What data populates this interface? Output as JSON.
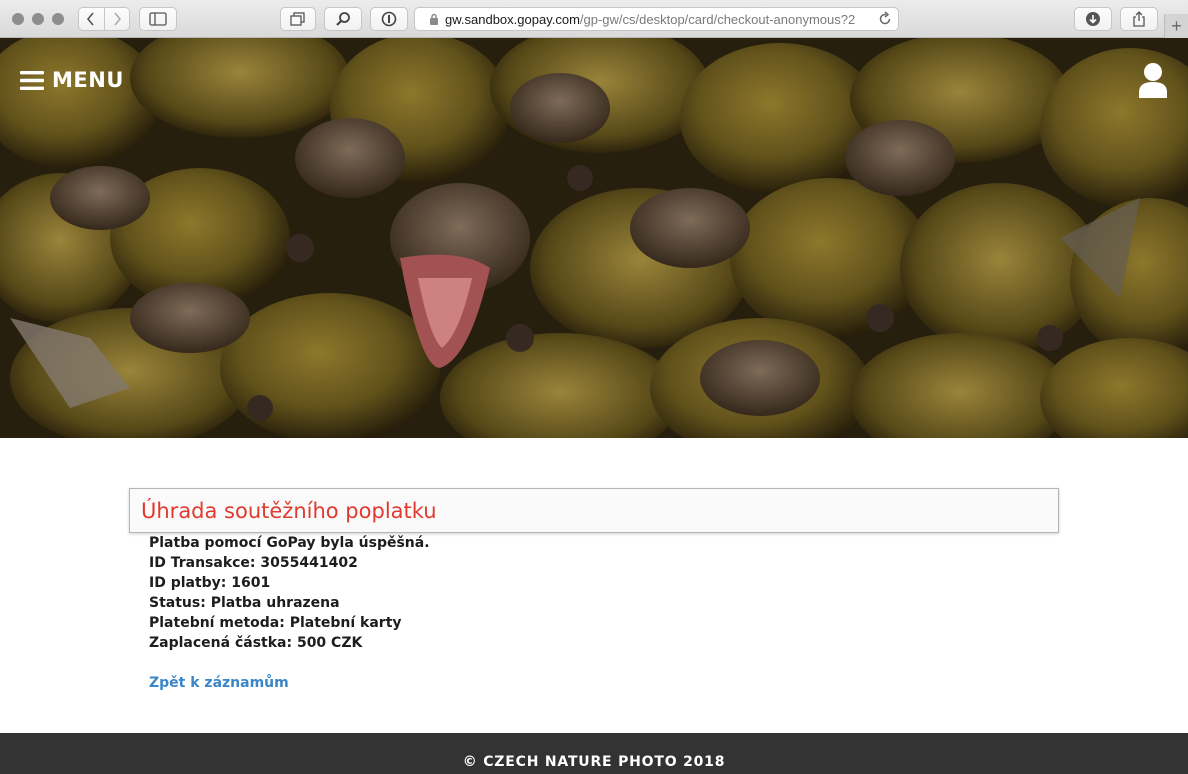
{
  "browser": {
    "url_host": "gw.sandbox.gopay.com",
    "url_path": "/gp-gw/cs/desktop/card/checkout-anonymous?2"
  },
  "header": {
    "menu_label": "MENU",
    "menu_icon": "hamburger-icon",
    "user_icon": "user-icon"
  },
  "hero": {
    "image_description_icon": "photo-banner"
  },
  "payment": {
    "title": "Úhrada soutěžního poplatku",
    "lines": [
      "Platba pomocí GoPay byla úspěšná.",
      "ID Transakce: 3055441402",
      "ID platby: 1601",
      "Status: Platba uhrazena",
      "Platební metoda: Platební karty",
      "Zaplacená částka: 500 CZK"
    ],
    "back_link": "Zpět k záznamům",
    "title_color": "#e03a2f",
    "link_color": "#3a86c8"
  },
  "footer": {
    "text": "© CZECH NATURE PHOTO 2018"
  }
}
